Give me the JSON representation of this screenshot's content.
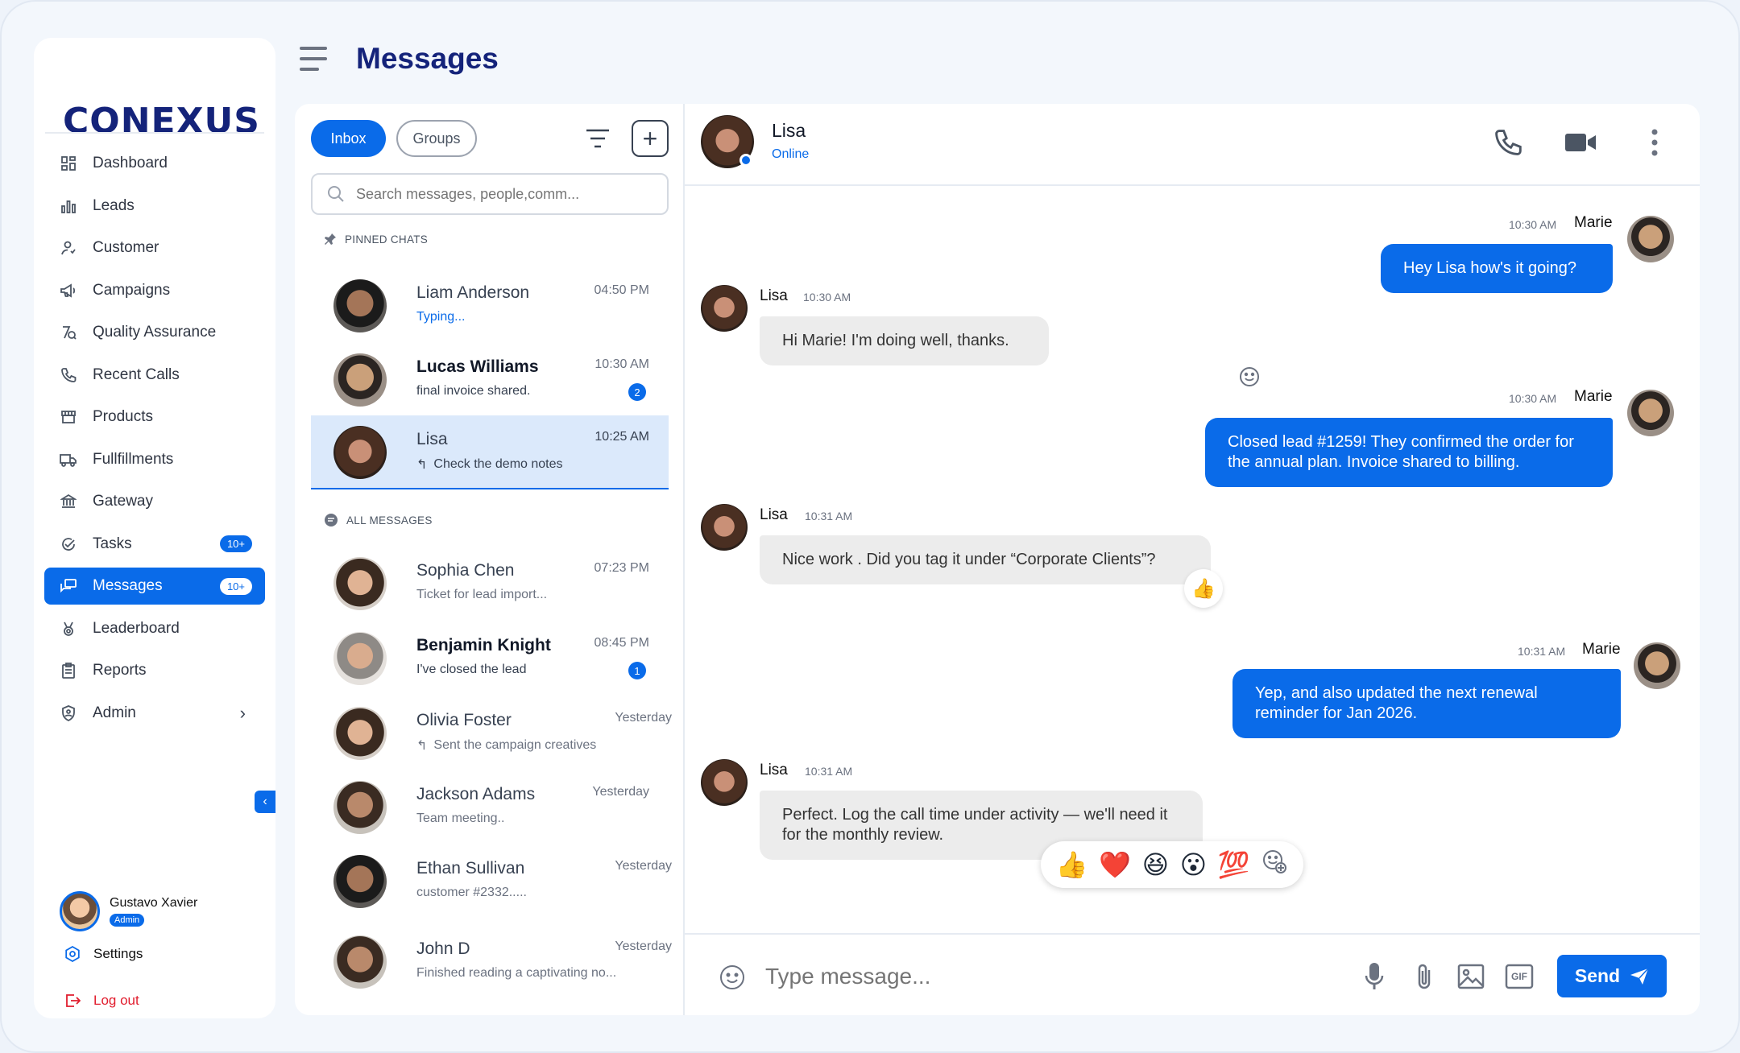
{
  "brand": {
    "logo": "CONEXUS"
  },
  "sidebar": {
    "items": [
      {
        "label": "Dashboard",
        "icon": "grid-icon"
      },
      {
        "label": "Leads",
        "icon": "bar-chart-icon"
      },
      {
        "label": "Customer",
        "icon": "user-icon"
      },
      {
        "label": "Campaigns",
        "icon": "megaphone-icon"
      },
      {
        "label": "Quality Assurance",
        "icon": "qa-icon"
      },
      {
        "label": "Recent Calls",
        "icon": "phone-icon"
      },
      {
        "label": "Products",
        "icon": "store-icon"
      },
      {
        "label": "Fullfillments",
        "icon": "truck-icon"
      },
      {
        "label": "Gateway",
        "icon": "bank-icon"
      },
      {
        "label": "Tasks",
        "icon": "task-icon",
        "badge": "10+"
      },
      {
        "label": "Messages",
        "icon": "chat-icon",
        "badge": "10+",
        "active": true
      },
      {
        "label": "Leaderboard",
        "icon": "medal-icon"
      },
      {
        "label": "Reports",
        "icon": "clipboard-icon"
      },
      {
        "label": "Admin",
        "icon": "shield-icon"
      }
    ],
    "user": {
      "name": "Gustavo Xavier",
      "role": "Admin"
    },
    "settings_label": "Settings",
    "logout_label": "Log out"
  },
  "header": {
    "title": "Messages"
  },
  "chat_list": {
    "tabs": {
      "inbox": "Inbox",
      "groups": "Groups"
    },
    "search_placeholder": "Search messages, people,comm...",
    "pinned_label": "PINNED CHATS",
    "all_label": "ALL MESSAGES",
    "pinned": [
      {
        "name": "Liam Anderson",
        "preview": "Typing...",
        "time": "04:50 PM"
      },
      {
        "name": "Lucas Williams",
        "preview": "final invoice shared.",
        "time": "10:30 AM",
        "unread": "2"
      },
      {
        "name": "Lisa",
        "preview": "Check the demo notes",
        "time": "10:25 AM"
      }
    ],
    "all": [
      {
        "name": "Sophia Chen",
        "preview": "Ticket for lead import...",
        "time": "07:23 PM"
      },
      {
        "name": "Benjamin Knight",
        "preview": "I've closed the lead",
        "time": "08:45 PM",
        "unread": "1"
      },
      {
        "name": "Olivia Foster",
        "preview": "Sent the campaign creatives",
        "time": "Yesterday"
      },
      {
        "name": "Jackson Adams",
        "preview": "Team meeting..",
        "time": "Yesterday"
      },
      {
        "name": "Ethan Sullivan",
        "preview": "customer #2332.....",
        "time": "Yesterday"
      },
      {
        "name": "John D",
        "preview": "Finished reading a captivating no...",
        "time": "Yesterday"
      }
    ]
  },
  "conversation": {
    "contact": {
      "name": "Lisa",
      "status": "Online"
    },
    "messages": [
      {
        "sender": "Marie",
        "time": "10:30 AM",
        "text": "Hey Lisa how's it going?"
      },
      {
        "sender": "Lisa",
        "time": "10:30 AM",
        "text": "Hi Marie! I'm doing well, thanks."
      },
      {
        "sender": "Marie",
        "time": "10:30 AM",
        "text": "Closed lead #1259! They confirmed the order for the annual plan. Invoice shared to billing."
      },
      {
        "sender": "Lisa",
        "time": "10:31 AM",
        "text": "Nice work . Did you tag it under “Corporate Clients”?",
        "reaction": "👍"
      },
      {
        "sender": "Marie",
        "time": "10:31 AM",
        "text": "Yep, and also updated the next renewal reminder for Jan 2026."
      },
      {
        "sender": "Lisa",
        "time": "10:31 AM",
        "text": "Perfect. Log the call time under activity — we'll need it for the monthly review."
      }
    ],
    "emoji_picker": [
      "👍",
      "❤️",
      "😆",
      "😮",
      "💯"
    ],
    "composer": {
      "placeholder": "Type message...",
      "send_label": "Send",
      "gif_label": "GIF"
    }
  }
}
